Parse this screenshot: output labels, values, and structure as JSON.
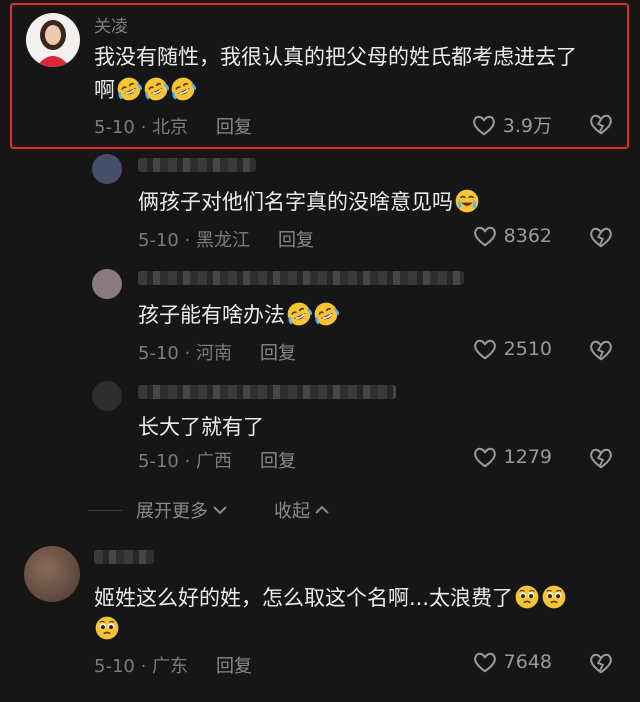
{
  "comments": [
    {
      "username": "关凌",
      "text": "我没有随性，我很认真的把父母的姓氏都考虑进去了",
      "text_line2": "啊",
      "emoji_count": 3,
      "date_location": "5-10 · 北京",
      "reply_label": "回复",
      "likes": "3.9万",
      "highlighted": true
    },
    {
      "username": "",
      "text": "俩孩子对他们名字真的没啥意见吗",
      "emoji_count": 1,
      "date_location": "5-10 · 黑龙江",
      "reply_label": "回复",
      "likes": "8362"
    },
    {
      "username": "",
      "text": "孩子能有啥办法",
      "emoji_count": 2,
      "date_location": "5-10 · 河南",
      "reply_label": "回复",
      "likes": "2510"
    },
    {
      "username": "",
      "text": "长大了就有了",
      "emoji_count": 0,
      "date_location": "5-10 · 广西",
      "reply_label": "回复",
      "likes": "1279"
    },
    {
      "username": "",
      "text": "姬姓这么好的姓，怎么取这个名啊...太浪费了",
      "emoji_count": 3,
      "date_location": "5-10 · 广东",
      "reply_label": "回复",
      "likes": "7648"
    }
  ],
  "thread_controls": {
    "expand_more": "展开更多",
    "collapse": "收起"
  },
  "colors": {
    "background": "#161616",
    "highlight_border": "#e42b2b",
    "muted_text": "#7b7b7b",
    "emoji_yellow": "#f7c531"
  },
  "icons": {
    "like": "heart-outline-icon",
    "dislike": "broken-heart-icon",
    "expand": "chevron-down-icon",
    "collapse": "chevron-up-icon",
    "laugh_emoji": "rofl-emoji",
    "cry_emoji": "laugh-cry-emoji",
    "pleading_emoji": "pleading-face-emoji"
  }
}
